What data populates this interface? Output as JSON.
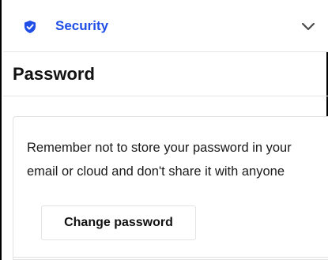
{
  "section": {
    "title": "Security",
    "icon": "shield-check-icon",
    "toggle_icon": "chevron-down-icon",
    "accent_color": "#1f4fe6"
  },
  "password": {
    "heading": "Password",
    "message": "Remember not to store your password in your email or cloud and don't share it with anyone",
    "change_button_label": "Change password"
  }
}
